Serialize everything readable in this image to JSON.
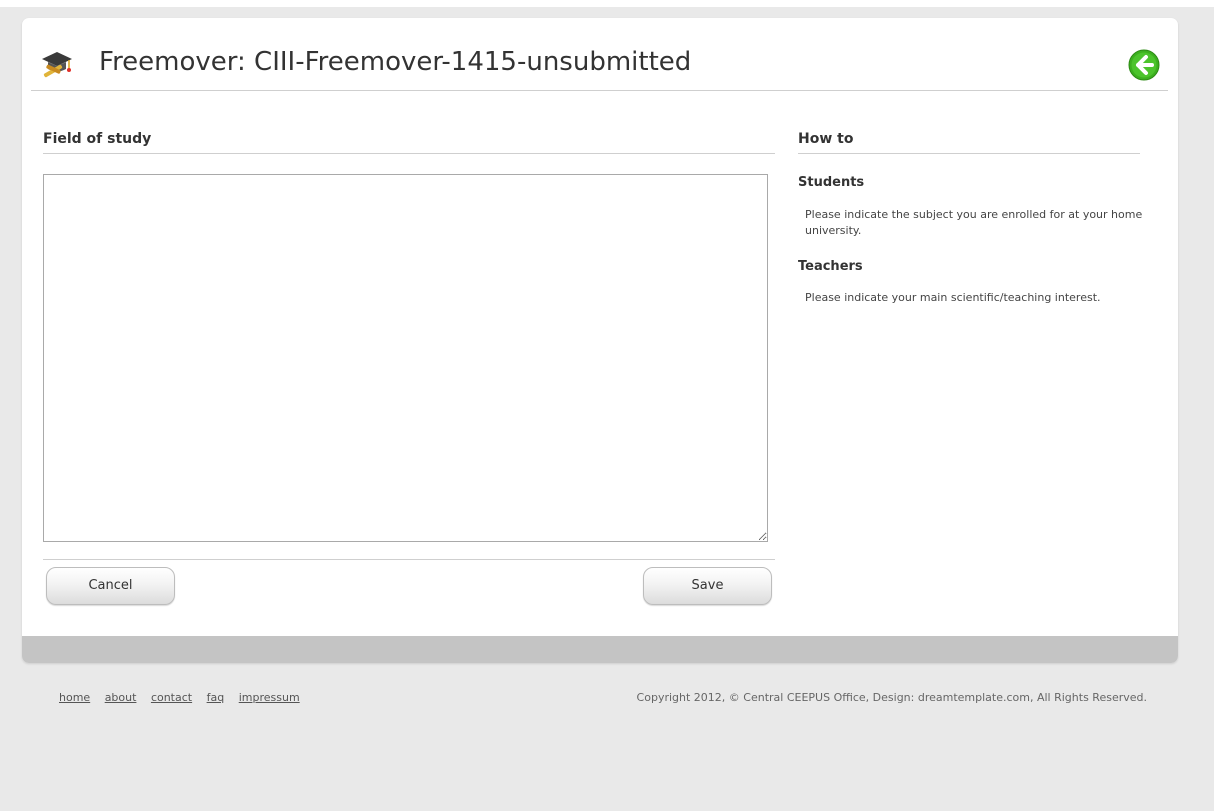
{
  "header": {
    "title": "Freemover: CIII-Freemover-1415-unsubmitted",
    "icon": "graduation-cap-icon",
    "back_icon": "back-arrow-icon"
  },
  "form": {
    "heading": "Field of study",
    "field_value": "",
    "cancel_label": "Cancel",
    "save_label": "Save"
  },
  "howto": {
    "heading": "How to",
    "students_heading": "Students",
    "students_text": "Please indicate the subject you are enrolled for at your home university.",
    "teachers_heading": "Teachers",
    "teachers_text": "Please indicate your main scientific/teaching interest."
  },
  "footer": {
    "links": [
      "home",
      "about",
      "contact",
      "faq",
      "impressum"
    ],
    "copyright": "Copyright 2012, © Central CEEPUS Office, Design: dreamtemplate.com, All Rights Reserved."
  },
  "colors": {
    "background": "#e9e9e9",
    "panel": "#ffffff",
    "panel_bar": "#c4c4c4",
    "back_button": "#3cb01f"
  }
}
